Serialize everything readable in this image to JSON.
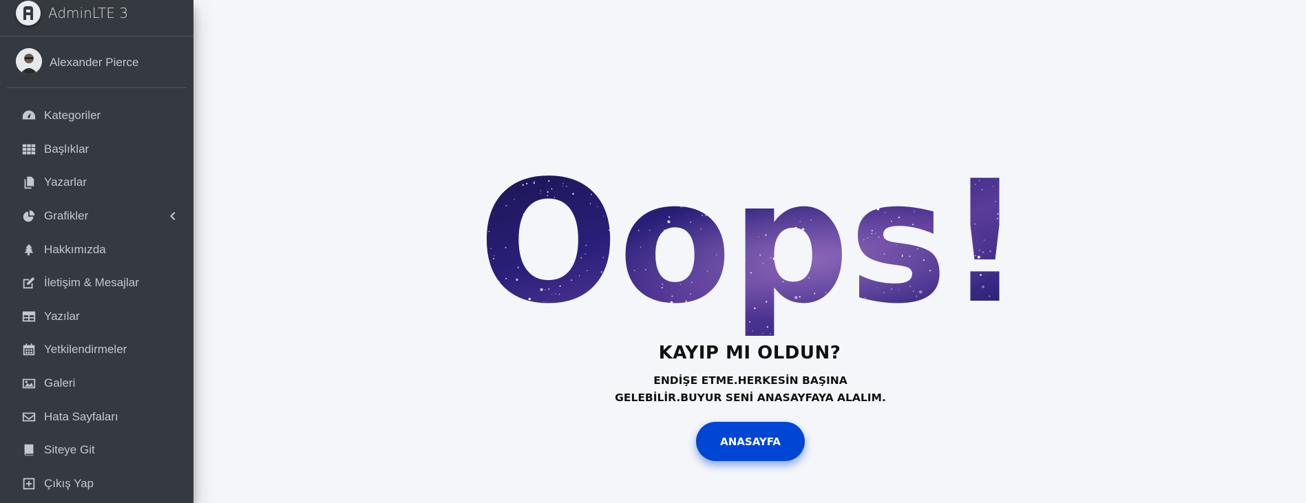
{
  "brand": {
    "title": "AdminLTE 3"
  },
  "user": {
    "name": "Alexander Pierce"
  },
  "sidebar": {
    "items": [
      {
        "label": "Kategoriler",
        "icon": "tachometer-icon"
      },
      {
        "label": "Başlıklar",
        "icon": "grid-icon"
      },
      {
        "label": "Yazarlar",
        "icon": "copy-icon"
      },
      {
        "label": "Grafikler",
        "icon": "pie-chart-icon",
        "caret": true
      },
      {
        "label": "Hakkımızda",
        "icon": "tree-icon"
      },
      {
        "label": "İletişim & Mesajlar",
        "icon": "edit-icon"
      },
      {
        "label": "Yazılar",
        "icon": "table-icon"
      },
      {
        "label": "Yetkilendirmeler",
        "icon": "calendar-icon"
      },
      {
        "label": "Galeri",
        "icon": "image-icon"
      },
      {
        "label": "Hata Sayfaları",
        "icon": "envelope-icon"
      },
      {
        "label": "Siteye Git",
        "icon": "book-icon"
      },
      {
        "label": "Çıkış Yap",
        "icon": "plus-square-icon"
      }
    ]
  },
  "error": {
    "headline": "Oops!",
    "subtitle": "KAYIP MI OLDUN?",
    "message": "ENDİŞE ETME.HERKESİN BAŞINA GELEBİLİR.BUYUR SENİ ANASAYFAYA ALALIM.",
    "button_label": "ANASAYFA"
  },
  "colors": {
    "sidebar_bg": "#343a40",
    "sidebar_text": "#c2c7d0",
    "page_bg": "#f4f6f9",
    "button_bg": "#0046d5",
    "button_text": "#ffffff"
  }
}
